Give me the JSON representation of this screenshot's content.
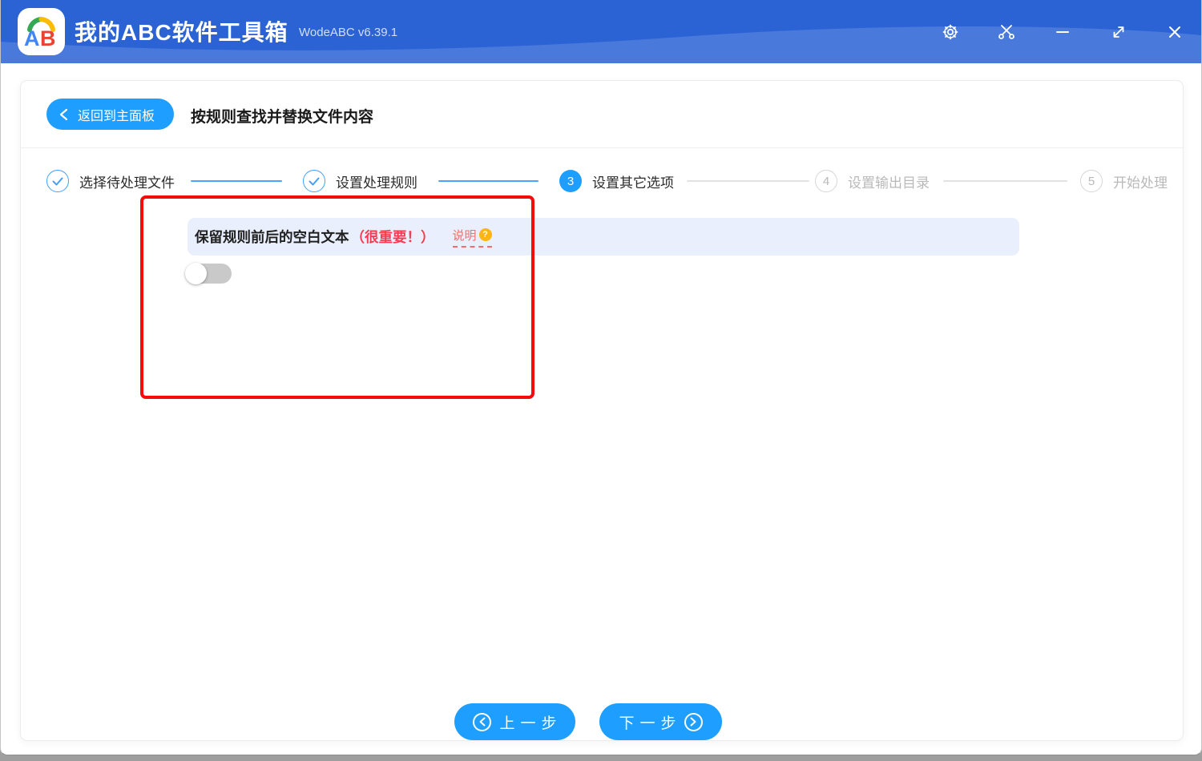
{
  "header": {
    "logo_text": "AB",
    "app_title": "我的ABC软件工具箱",
    "version": "WodeABC v6.39.1"
  },
  "toolbar": {
    "back_label": "返回到主面板",
    "page_title": "按规则查找并替换文件内容"
  },
  "steps": [
    {
      "label": "选择待处理文件",
      "state": "done"
    },
    {
      "label": "设置处理规则",
      "state": "done"
    },
    {
      "label": "设置其它选项",
      "state": "current",
      "number": "3"
    },
    {
      "label": "设置输出目录",
      "state": "pending",
      "number": "4"
    },
    {
      "label": "开始处理",
      "state": "pending",
      "number": "5"
    }
  ],
  "content": {
    "option_label": "保留规则前后的空白文本",
    "option_important": "（很重要！）",
    "help_link": "说明",
    "help_icon": "?",
    "toggle_state": "off"
  },
  "footer": {
    "prev_label": "上一步",
    "next_label": "下一步"
  },
  "colors": {
    "header_blue": "#2b63d5",
    "accent_blue": "#1e9fff",
    "step_blue": "#41a0ff",
    "annotation_red": "#f40b0b",
    "important_red": "#f73b52",
    "help_red": "#f56c6c",
    "help_gold": "#fdb515",
    "banner_bg": "#e9effc",
    "toggle_grey": "#c9c9c9"
  }
}
